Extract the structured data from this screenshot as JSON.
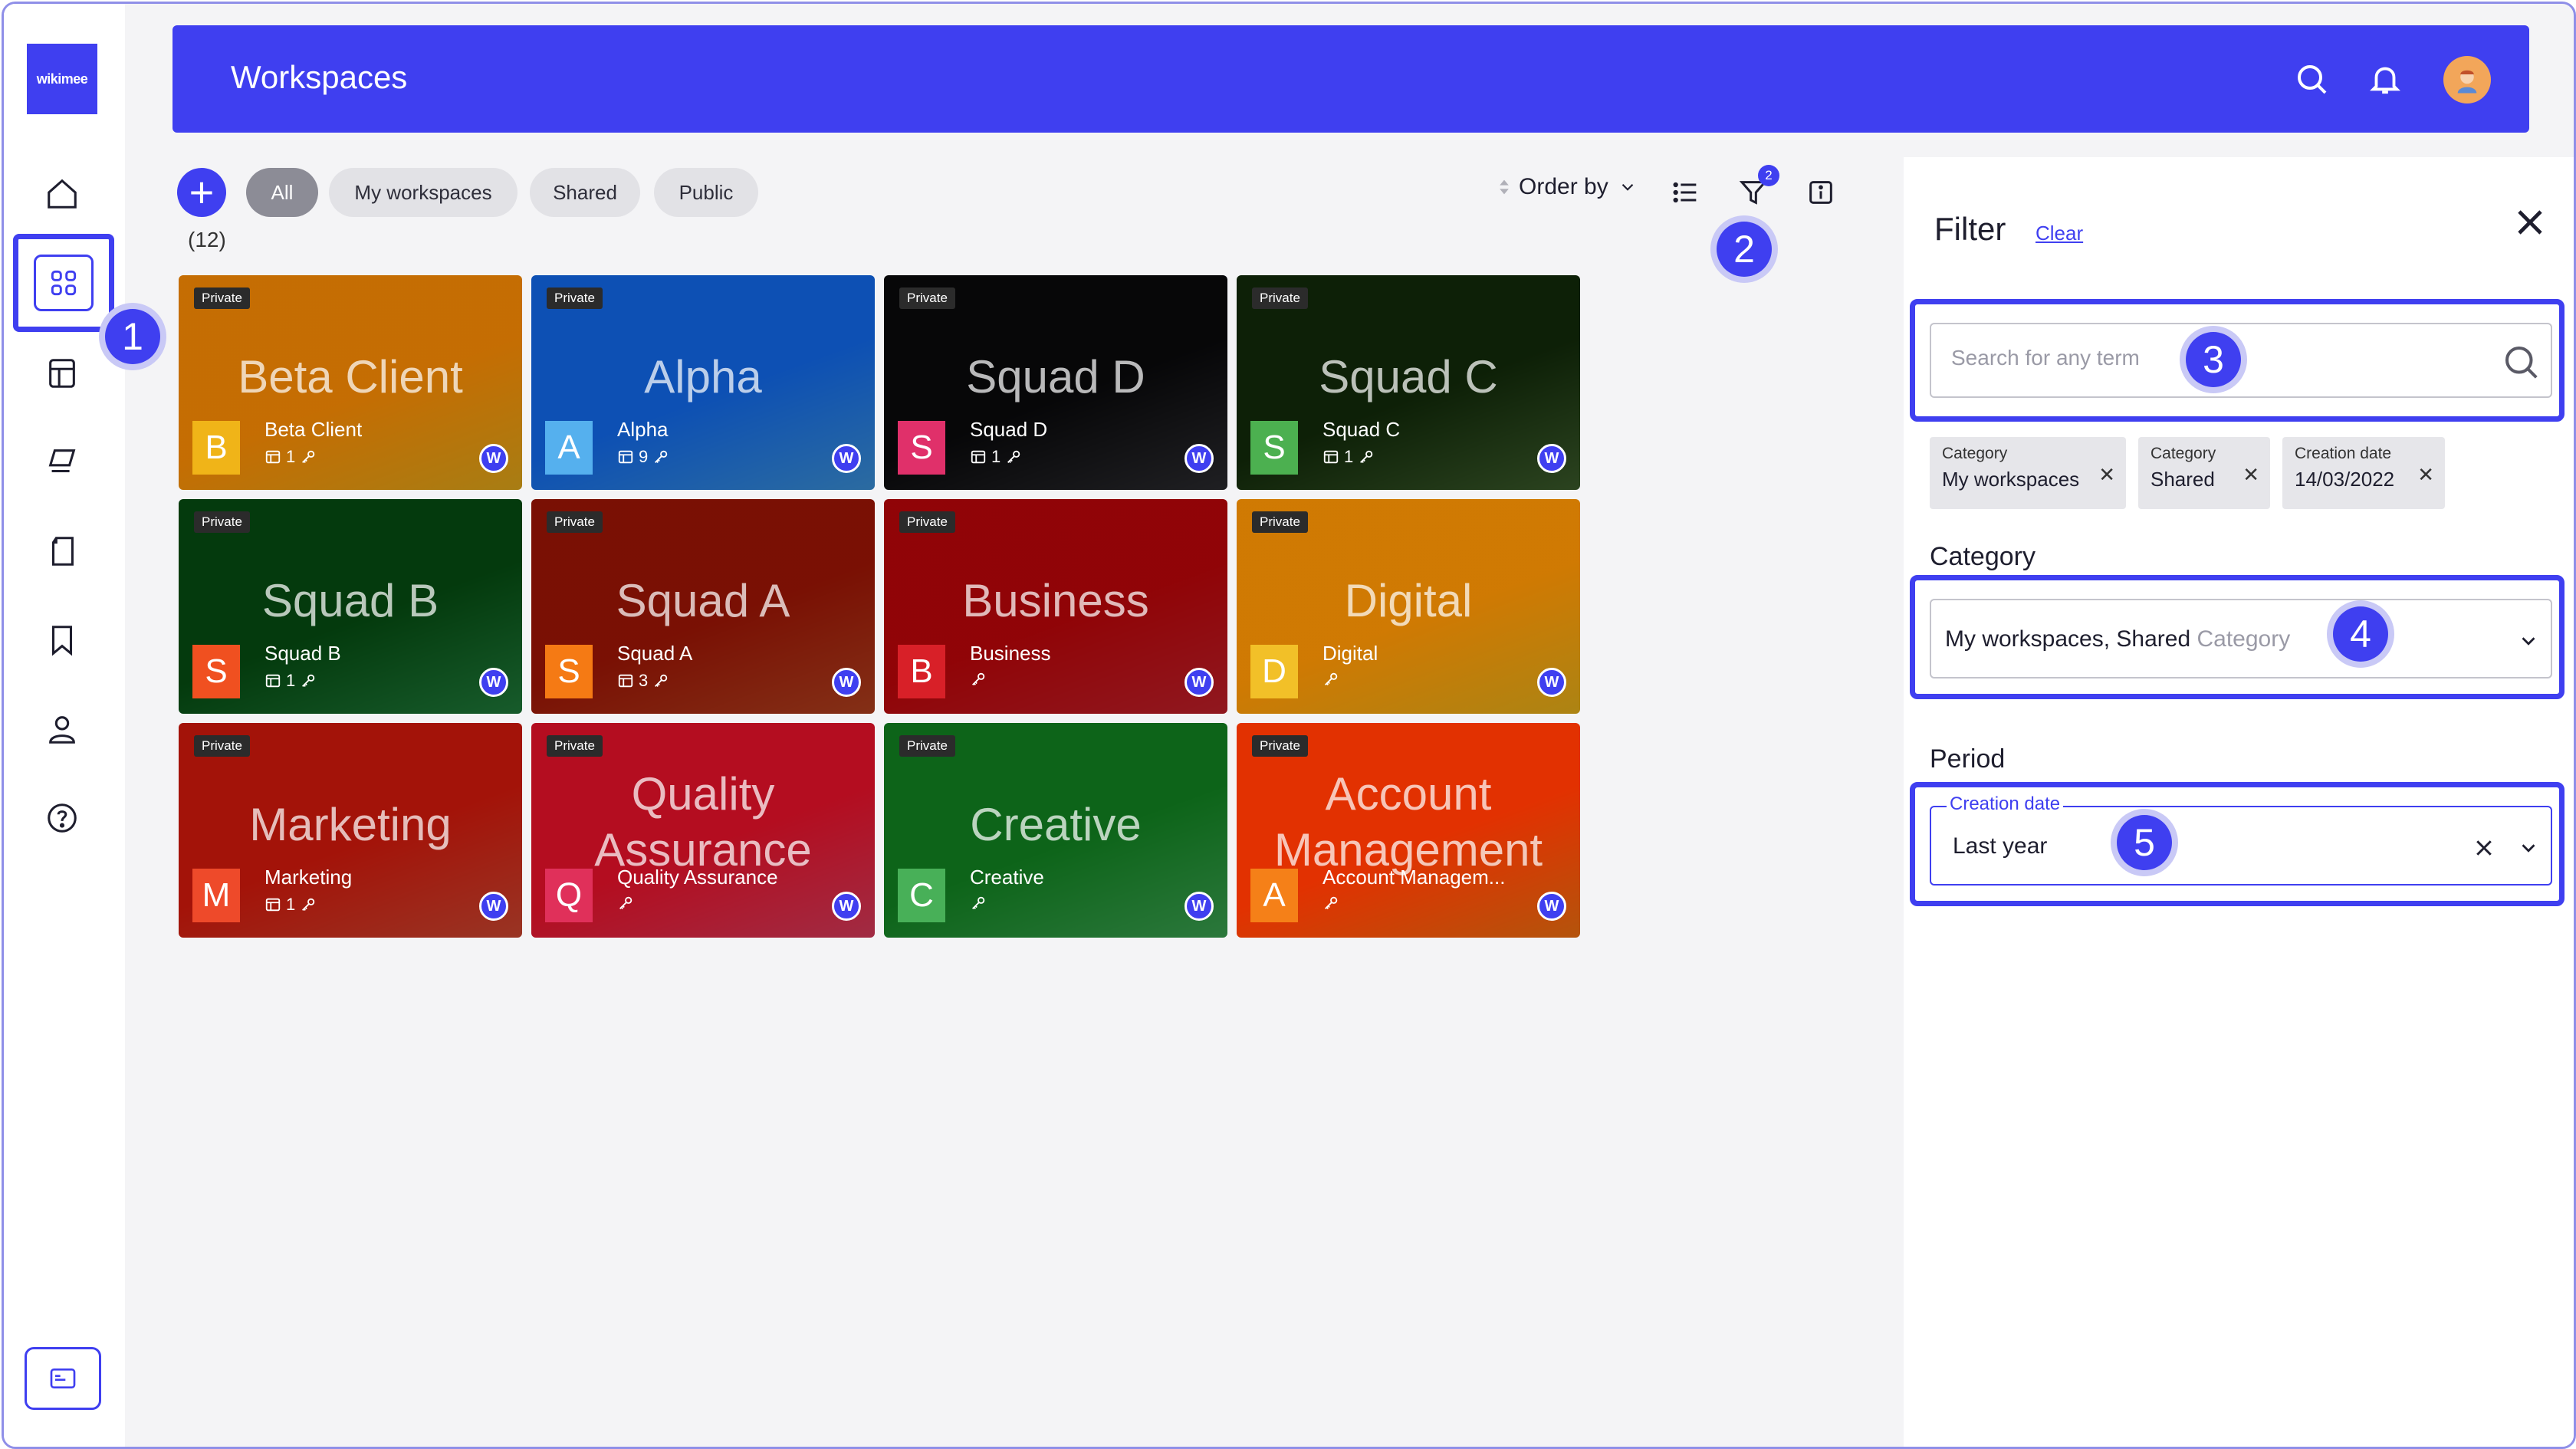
{
  "app": {
    "logo_text": "wikimee",
    "title": "Workspaces"
  },
  "sidebar": {
    "items": [
      {
        "name": "home-icon"
      },
      {
        "name": "workspaces-icon"
      },
      {
        "name": "layout-icon"
      },
      {
        "name": "stack-icon"
      },
      {
        "name": "notebook-icon"
      },
      {
        "name": "bookmark-icon"
      },
      {
        "name": "user-icon"
      },
      {
        "name": "help-icon"
      }
    ],
    "bottom_icon": "card-icon"
  },
  "callouts": [
    "1",
    "2",
    "3",
    "4",
    "5"
  ],
  "toolbar": {
    "add_label": "+",
    "chips": [
      "All",
      "My workspaces",
      "Shared",
      "Public"
    ],
    "active_chip": "All",
    "count": "(12)",
    "order_by": "Order by",
    "filter_count": "2"
  },
  "cards": [
    {
      "title": "Beta Client",
      "name": "Beta Client",
      "letter": "B",
      "badge": "Private",
      "meta_count": "1",
      "show_count": true
    },
    {
      "title": "Alpha",
      "name": "Alpha",
      "letter": "A",
      "badge": "Private",
      "meta_count": "9",
      "show_count": true
    },
    {
      "title": "Squad D",
      "name": "Squad D",
      "letter": "S",
      "badge": "Private",
      "meta_count": "1",
      "show_count": true
    },
    {
      "title": "Squad C",
      "name": "Squad C",
      "letter": "S",
      "badge": "Private",
      "meta_count": "1",
      "show_count": true
    },
    {
      "title": "Squad B",
      "name": "Squad B",
      "letter": "S",
      "badge": "Private",
      "meta_count": "1",
      "show_count": true
    },
    {
      "title": "Squad A",
      "name": "Squad A",
      "letter": "S",
      "badge": "Private",
      "meta_count": "3",
      "show_count": true
    },
    {
      "title": "Business",
      "name": "Business",
      "letter": "B",
      "badge": "Private",
      "meta_count": "",
      "show_count": false
    },
    {
      "title": "Digital",
      "name": "Digital",
      "letter": "D",
      "badge": "Private",
      "meta_count": "",
      "show_count": false
    },
    {
      "title": "Marketing",
      "name": "Marketing",
      "letter": "M",
      "badge": "Private",
      "meta_count": "1",
      "show_count": true
    },
    {
      "title": "Quality Assurance",
      "name": "Quality Assurance",
      "letter": "Q",
      "badge": "Private",
      "meta_count": "",
      "show_count": false
    },
    {
      "title": "Creative",
      "name": "Creative",
      "letter": "C",
      "badge": "Private",
      "meta_count": "",
      "show_count": false
    },
    {
      "title": "Account Management",
      "name": "Account Managem...",
      "letter": "A",
      "badge": "Private",
      "meta_count": "",
      "show_count": false
    }
  ],
  "card_owner_badge": "W",
  "filter": {
    "title": "Filter",
    "clear": "Clear",
    "search_placeholder": "Search for any term",
    "tags": [
      {
        "label": "Category",
        "value": "My workspaces"
      },
      {
        "label": "Category",
        "value": "Shared"
      },
      {
        "label": "Creation date",
        "value": "14/03/2022"
      }
    ],
    "category_label": "Category",
    "category_value": "My workspaces, Shared",
    "category_placeholder": "Category",
    "period_label": "Period",
    "period_legend": "Creation date",
    "period_value": "Last year"
  },
  "colors": {
    "accent": "#3f3ff0",
    "card_colors": [
      "#e0a71a",
      "#3a8fd6",
      "#2a2a2e",
      "#3a5a2a",
      "#1f7a3a",
      "#b0401e",
      "#c0202a",
      "#e6b01a",
      "#cc4630",
      "#d63a5a",
      "#3aa050",
      "#f07010"
    ]
  }
}
